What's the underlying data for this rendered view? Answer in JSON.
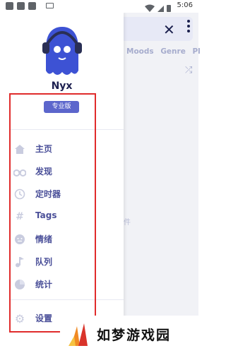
{
  "status_bar": {
    "time": "5:06"
  },
  "background_screen": {
    "tabs": [
      "Moods",
      "Genre",
      "Pl"
    ],
    "fragment_text": "件"
  },
  "drawer": {
    "app_name": "Nyx",
    "badge": "专业版",
    "items": [
      {
        "label": "主页",
        "icon": "home-icon"
      },
      {
        "label": "发现",
        "icon": "binoculars-icon"
      },
      {
        "label": "定时器",
        "icon": "clock-icon"
      },
      {
        "label": "Tags",
        "icon": "hash-icon"
      },
      {
        "label": "情绪",
        "icon": "face-icon"
      },
      {
        "label": "队列",
        "icon": "music-note-icon"
      },
      {
        "label": "统计",
        "icon": "pie-chart-icon"
      }
    ],
    "settings": {
      "label": "设置",
      "icon": "gear-icon"
    }
  },
  "watermark": {
    "text": "如梦游戏园"
  },
  "colors": {
    "accent": "#5c66cc",
    "menu_text": "#4b5099",
    "highlight": "#e02b2b",
    "title": "#1d2050"
  }
}
